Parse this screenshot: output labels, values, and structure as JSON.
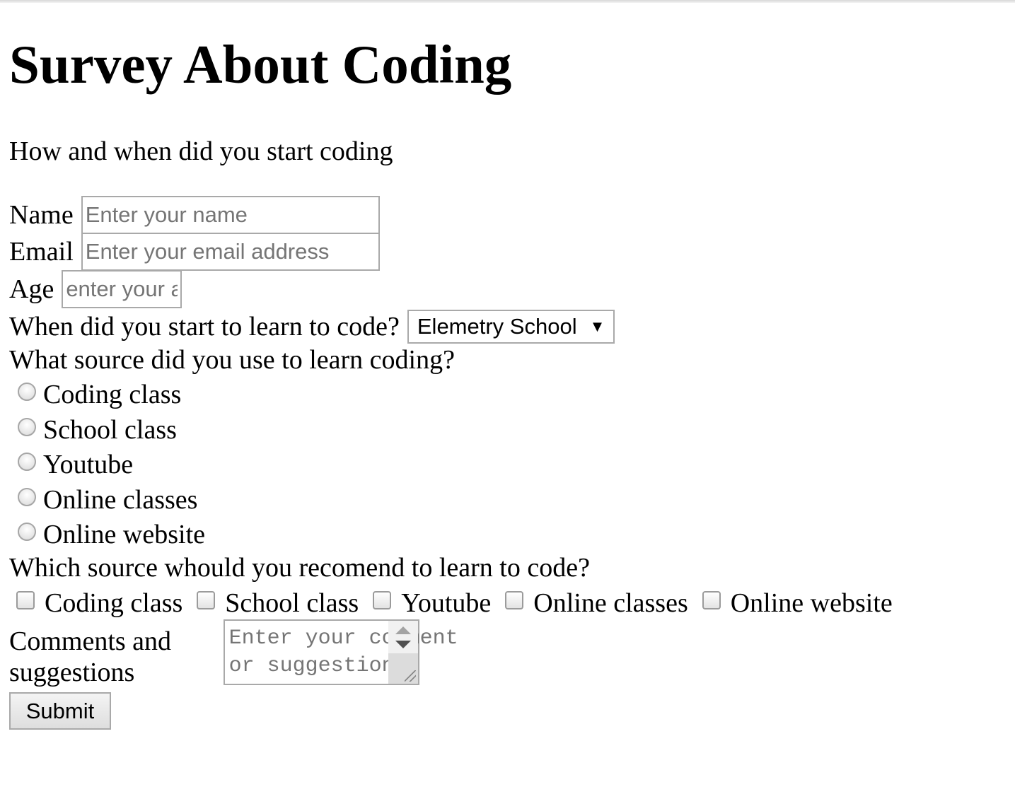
{
  "page": {
    "title": "Survey About Coding",
    "description": "How and when did you start coding"
  },
  "form": {
    "name": {
      "label": "Name",
      "placeholder": "Enter your name",
      "value": ""
    },
    "email": {
      "label": "Email",
      "placeholder": "Enter your email address",
      "value": ""
    },
    "age": {
      "label": "Age",
      "placeholder": "enter your age",
      "value": ""
    },
    "start": {
      "label": "When did you start to learn to code?",
      "selected": "Elemetry School"
    },
    "source": {
      "question": "What source did you use to learn coding?",
      "options": [
        "Coding class",
        "School class",
        "Youtube",
        "Online classes",
        "Online website"
      ]
    },
    "recommend": {
      "question": "Which source whould you recomend to learn to code?",
      "options": [
        "Coding class",
        "School class",
        "Youtube",
        "Online classes",
        "Online website"
      ]
    },
    "comments": {
      "label": "Comments and suggestions",
      "placeholder": "Enter your comment or suggestion",
      "value": ""
    },
    "submit_label": "Submit"
  },
  "colors": {
    "input_border": "#a9a9a9",
    "placeholder": "#757575",
    "button_bg": "#e9e9e9"
  },
  "icons": {
    "select_arrow": "triangle-down-icon",
    "textarea_resize": "resize-grip-icon"
  }
}
